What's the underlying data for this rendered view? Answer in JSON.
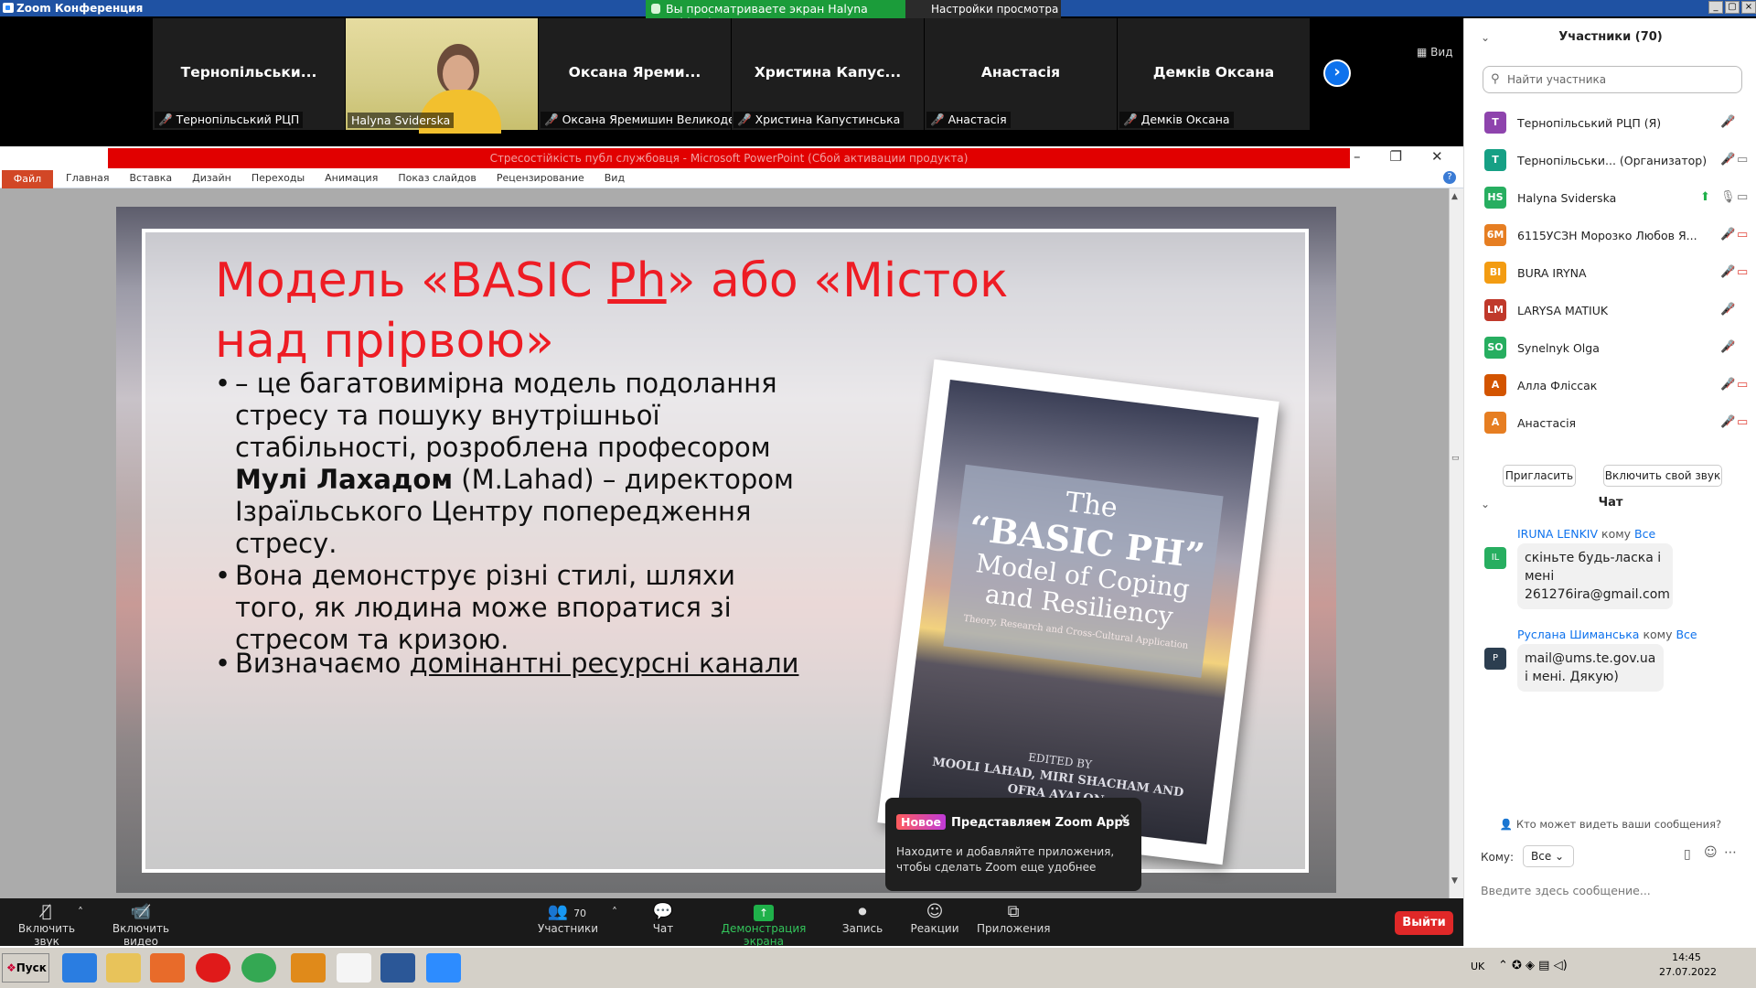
{
  "window": {
    "title": "Zoom Конференция"
  },
  "share_banner": {
    "text": "Вы просматриваете экран Halyna Sviderska"
  },
  "view_settings": {
    "label": "Настройки просмотра ⌄"
  },
  "view_button": {
    "label": "Вид"
  },
  "gallery": [
    {
      "name": "Тернопільськи...",
      "label": "Тернопільський РЦП",
      "muted": true
    },
    {
      "name": "",
      "label": "Halyna Sviderska",
      "muted": false,
      "video": true
    },
    {
      "name": "Оксана  Яреми...",
      "label": "Оксана Яремишин Великоде...",
      "muted": true
    },
    {
      "name": "Христина  Капус...",
      "label": "Христина Капустинська",
      "muted": true
    },
    {
      "name": "Анастасія",
      "label": "Анастасія",
      "muted": true
    },
    {
      "name": "Демків Оксана",
      "label": "Демків Оксана",
      "muted": true
    }
  ],
  "ppt": {
    "title": "Стресостійкість публ службовця  -  Microsoft PowerPoint (Сбой активации продукта)",
    "file_tab": "Файл",
    "tabs": [
      "Главная",
      "Вставка",
      "Дизайн",
      "Переходы",
      "Анимация",
      "Показ слайдов",
      "Рецензирование",
      "Вид"
    ]
  },
  "slide": {
    "title_1": "Модель «BASIC ",
    "title_ph": "Ph",
    "title_2": "» або «Місток над прірвою»",
    "b1_a": "– це багатовимірна модель подолання стресу та пошуку внутрішньої стабільності, розроблена професором ",
    "b1_bold": "Мулі Лахадом",
    "b1_b": " (M.Lahad) – директором Ізраїльського Центру попередження  стресу.",
    "b2": "Вона демонструє різні стилі, шляхи того, як людина може впоратися зі стресом та кризою.",
    "b3_a": "Визначаємо ",
    "b3_u": "домінантні ресурсні канали",
    "book": {
      "the": "The",
      "basic": "“BASIC PH”",
      "model": "Model of Coping and Resiliency",
      "sub": "Theory, Research and Cross-Cultural Application",
      "edited": "EDITED BY",
      "editors": "MOOLI LAHAD, MIRI SHACHAM AND OFRA AYALON"
    }
  },
  "zoom_apps": {
    "badge": "Новое",
    "heading": "Представляем Zoom Apps",
    "description": "Находите и добавляйте приложения, чтобы сделать Zoom еще удобнее"
  },
  "toolbar": {
    "mute": "Включить звук",
    "video": "Включить видео",
    "participants": "Участники",
    "participants_count": "70",
    "chat": "Чат",
    "share": "Демонстрация экрана",
    "record": "Запись",
    "reactions": "Реакции",
    "apps": "Приложения",
    "leave": "Выйти"
  },
  "participants_panel": {
    "title": "Участники (70)",
    "search_placeholder": "Найти участника",
    "list": [
      {
        "initials": "Т",
        "name": "Тернопільський РЦП (Я)",
        "color": "#8e44ad"
      },
      {
        "initials": "Т",
        "name": "Тернопільськи...  (Организатор)",
        "color": "#16a085"
      },
      {
        "initials": "HS",
        "name": "Halyna Sviderska",
        "color": "#27ae60"
      },
      {
        "initials": "6М",
        "name": "6115УСЗН Морозко Любов Я...",
        "color": "#e67e22"
      },
      {
        "initials": "BI",
        "name": "BURA IRYNA",
        "color": "#f39c12"
      },
      {
        "initials": "LM",
        "name": "LARYSA MATIUK",
        "color": "#c0392b"
      },
      {
        "initials": "SO",
        "name": "Synelnyk Olga",
        "color": "#27ae60"
      },
      {
        "initials": "А",
        "name": "Алла Фліссак",
        "color": "#d35400"
      },
      {
        "initials": "А",
        "name": "Анастасія",
        "color": "#e67e22"
      }
    ],
    "invite": "Пригласить",
    "unmute_me": "Включить свой звук"
  },
  "chat_panel": {
    "title": "Чат",
    "messages": [
      {
        "from": "IRUNA LENKIV",
        "to_word": "кому",
        "to": "Все",
        "avatar": "IL",
        "avatar_color": "#27ae60",
        "text": "скіньте будь-ласка і мені 261276ira@gmail.com"
      },
      {
        "from": "Руслана Шиманська",
        "to_word": "кому",
        "to": "Все",
        "avatar": "Р",
        "avatar_color": "#2c3e50",
        "text": "mail@ums.te.gov.ua і мені. Дякую)"
      }
    ],
    "who_can_see": "Кто может видеть ваши сообщения?",
    "to_label": "Кому:",
    "to_value": "Все",
    "input_placeholder": "Введите здесь сообщение..."
  },
  "taskbar": {
    "start": "Пуск",
    "lang": "UK",
    "time": "14:45",
    "date": "27.07.2022"
  }
}
